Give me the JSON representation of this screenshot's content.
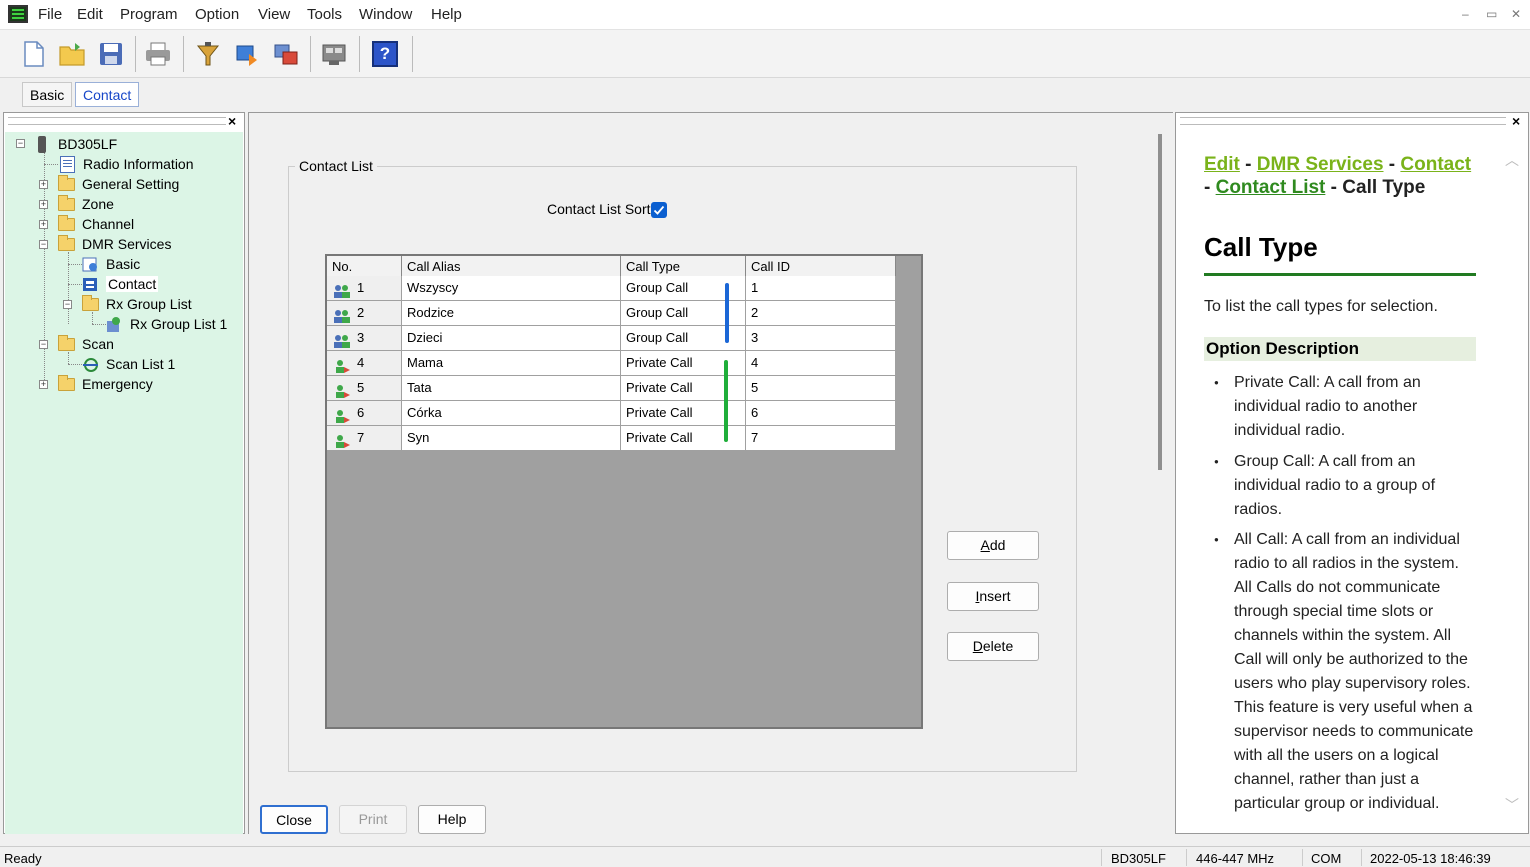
{
  "menu": [
    "File",
    "Edit",
    "Program",
    "Option",
    "View",
    "Tools",
    "Window",
    "Help"
  ],
  "window_controls": [
    "–",
    "▭",
    "✕"
  ],
  "toolbar": {
    "icons": [
      "new-file-icon",
      "open-folder-icon",
      "save-icon",
      "print-icon",
      "read-radio-icon",
      "write-radio-icon",
      "clone-icon",
      "settings-icon",
      "help-icon"
    ],
    "help_label": "?"
  },
  "tabs": [
    {
      "label": "Basic",
      "active": false
    },
    {
      "label": "Contact",
      "active": true
    }
  ],
  "panes": {
    "close_glyph": "×"
  },
  "tree": {
    "root": "BD305LF",
    "items": [
      {
        "label": "Radio Information"
      },
      {
        "label": "General Setting"
      },
      {
        "label": "Zone"
      },
      {
        "label": "Channel"
      },
      {
        "label": "DMR Services"
      },
      {
        "label": "Basic"
      },
      {
        "label": "Contact"
      },
      {
        "label": "Rx Group List"
      },
      {
        "label": "Rx Group List 1"
      },
      {
        "label": "Scan"
      },
      {
        "label": "Scan List 1"
      },
      {
        "label": "Emergency"
      }
    ],
    "expander_plus": "+",
    "expander_minus": "−"
  },
  "contact_list": {
    "group_title": "Contact List",
    "sort_label": "Contact List Sort",
    "sort_checked": true,
    "columns": [
      "No.",
      "Call Alias",
      "Call Type",
      "Call ID"
    ],
    "rows": [
      {
        "no": "1",
        "alias": "Wszyscy",
        "type": "Group Call",
        "id": "1",
        "icon": "group-call-icon"
      },
      {
        "no": "2",
        "alias": "Rodzice",
        "type": "Group Call",
        "id": "2",
        "icon": "group-call-icon"
      },
      {
        "no": "3",
        "alias": "Dzieci",
        "type": "Group Call",
        "id": "3",
        "icon": "group-call-icon"
      },
      {
        "no": "4",
        "alias": "Mama",
        "type": "Private Call",
        "id": "4",
        "icon": "private-call-icon"
      },
      {
        "no": "5",
        "alias": "Tata",
        "type": "Private Call",
        "id": "5",
        "icon": "private-call-icon"
      },
      {
        "no": "6",
        "alias": "Córka",
        "type": "Private Call",
        "id": "6",
        "icon": "private-call-icon"
      },
      {
        "no": "7",
        "alias": "Syn",
        "type": "Private Call",
        "id": "7",
        "icon": "private-call-icon"
      }
    ],
    "annotation_colors": {
      "group": "#1b67d6",
      "private": "#1fae3a"
    }
  },
  "side_buttons": {
    "add": {
      "mnemonic": "A",
      "rest": "dd"
    },
    "insert": {
      "mnemonic": "I",
      "rest": "nsert"
    },
    "delete": {
      "mnemonic": "D",
      "rest": "elete"
    }
  },
  "bottom_buttons": {
    "close": "Close",
    "print": "Print",
    "help": "Help"
  },
  "help": {
    "breadcrumb": [
      "Edit",
      "DMR Services",
      "Contact",
      "Contact List"
    ],
    "breadcrumb_sep": "-",
    "breadcrumb_current": "Call Type",
    "title": "Call Type",
    "intro": "To list the call types for selection.",
    "option_heading": "Option Description",
    "bullets": [
      "Private Call: A call from an individual radio to another individual radio.",
      "Group Call: A call from an individual radio to a group of radios.",
      "All Call: A call from an individual radio to all radios in the system. All Calls do not communicate through special time slots or channels within the system. All Call will only be authorized to the users who play supervisory roles. This feature is very useful when a supervisor needs to communicate with all the users on a logical channel, rather than just a particular group or individual."
    ],
    "scroll_up": "︿",
    "scroll_down": "﹀"
  },
  "status": {
    "left": "Ready",
    "model": "BD305LF",
    "freq": "446-447 MHz",
    "port": "COM",
    "datetime": "2022-05-13 18:46:39"
  }
}
